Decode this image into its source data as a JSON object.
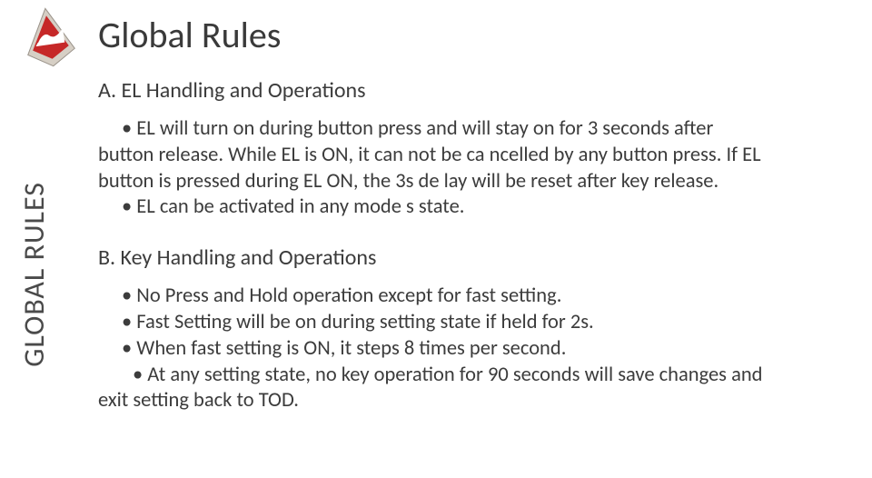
{
  "sidebar": {
    "label": "GLOBAL RULES"
  },
  "title": "Global Rules",
  "sectionA": {
    "heading": "A. EL Handling and Operations",
    "bullet1_line1": "EL will turn on during button press and will stay on for 3 seconds after",
    "bullet1_line2": "button release. While EL is ON, it can not be ca ncelled by any button press. If EL",
    "bullet1_line3": "button is pressed during EL ON, the 3s de lay will be reset after key release.",
    "bullet2": "EL can be activated in any mode s state."
  },
  "sectionB": {
    "heading": "B. Key Handling and Operations",
    "bullet1": "No Press and Hold operation except for fast setting.",
    "bullet2": "Fast Setting will be on during setting state if held for 2s.",
    "bullet3": "When fast setting is ON, it steps 8 times per second.",
    "bullet4_line1": "At any setting state, no key operation for 90 seconds will save changes and",
    "bullet4_line2": "exit setting back to TOD."
  }
}
